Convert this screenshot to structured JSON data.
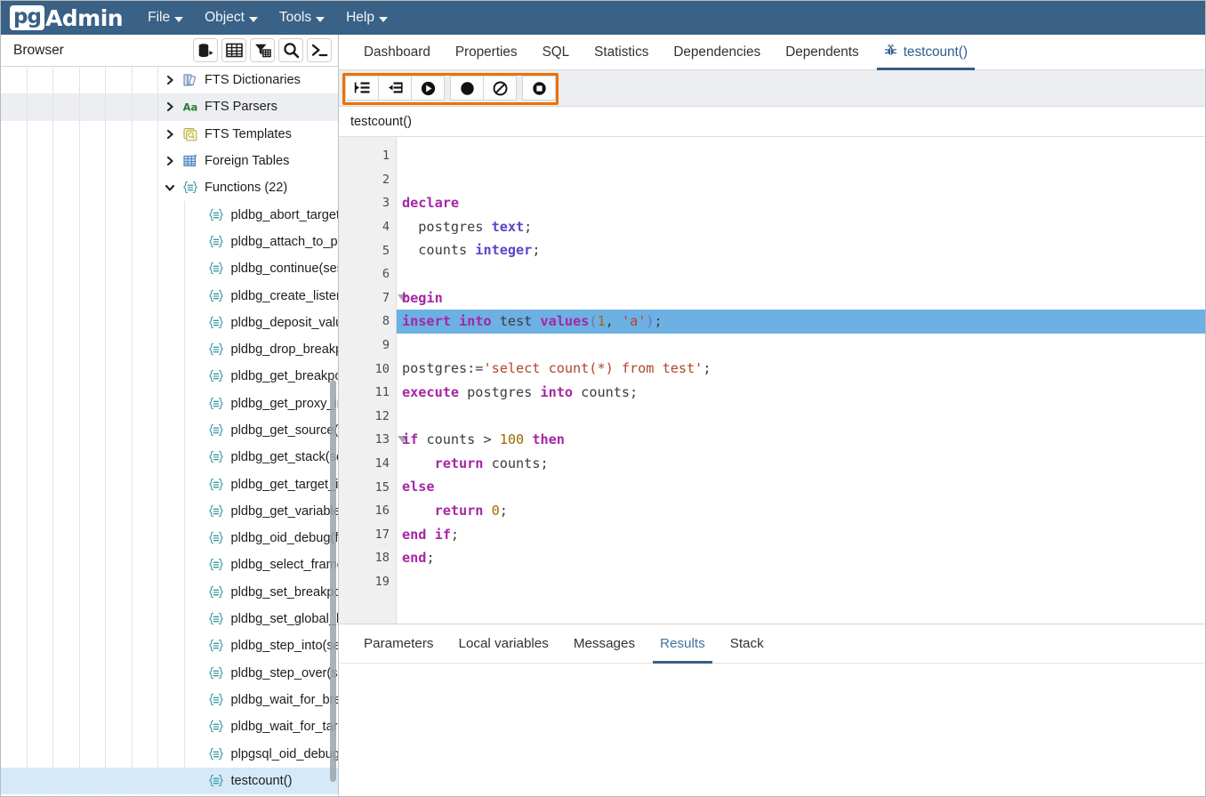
{
  "app": {
    "brand_pg": "pg",
    "brand_admin": "Admin",
    "menu": [
      {
        "label": "File",
        "icon": "chevron-down-icon"
      },
      {
        "label": "Object",
        "icon": "chevron-down-icon"
      },
      {
        "label": "Tools",
        "icon": "chevron-down-icon"
      },
      {
        "label": "Help",
        "icon": "chevron-down-icon"
      }
    ],
    "accent_blue": "#3a6186",
    "highlight_orange": "#f07000",
    "selected_row_blue": "#d6e9f8",
    "exec_line_blue": "#6cb0e4"
  },
  "browser": {
    "title": "Browser",
    "buttons": [
      {
        "name": "add-server-icon",
        "title": "Add New Server"
      },
      {
        "name": "table-grid-icon",
        "title": "View Data"
      },
      {
        "name": "filter-table-icon",
        "title": "Filtered Rows"
      },
      {
        "name": "search-icon",
        "title": "Search Objects"
      },
      {
        "name": "terminal-icon",
        "title": "PSQL Tool"
      }
    ],
    "tree": [
      {
        "label": "FTS Dictionaries",
        "icon": "fts-dictionaries-icon",
        "indent": 7,
        "twisty": "collapsed",
        "state": "normal"
      },
      {
        "label": "FTS Parsers",
        "icon": "fts-parsers-icon",
        "indent": 7,
        "twisty": "collapsed",
        "state": "hovered"
      },
      {
        "label": "FTS Templates",
        "icon": "fts-templates-icon",
        "indent": 7,
        "twisty": "collapsed",
        "state": "normal"
      },
      {
        "label": "Foreign Tables",
        "icon": "foreign-tables-icon",
        "indent": 7,
        "twisty": "collapsed",
        "state": "normal"
      },
      {
        "label": "Functions (22)",
        "icon": "functions-folder-icon",
        "indent": 7,
        "twisty": "expanded",
        "state": "normal"
      },
      {
        "label": "pldbg_abort_target(sess",
        "icon": "function-icon",
        "indent": 8,
        "twisty": "none",
        "state": "normal"
      },
      {
        "label": "pldbg_attach_to_port(po",
        "icon": "function-icon",
        "indent": 8,
        "twisty": "none",
        "state": "normal"
      },
      {
        "label": "pldbg_continue(session",
        "icon": "function-icon",
        "indent": 8,
        "twisty": "none",
        "state": "normal"
      },
      {
        "label": "pldbg_create_listener()",
        "icon": "function-icon",
        "indent": 8,
        "twisty": "none",
        "state": "normal"
      },
      {
        "label": "pldbg_deposit_value(ses",
        "icon": "function-icon",
        "indent": 8,
        "twisty": "none",
        "state": "normal"
      },
      {
        "label": "pldbg_drop_breakpoint(s",
        "icon": "function-icon",
        "indent": 8,
        "twisty": "none",
        "state": "normal"
      },
      {
        "label": "pldbg_get_breakpoints(s",
        "icon": "function-icon",
        "indent": 8,
        "twisty": "none",
        "state": "normal"
      },
      {
        "label": "pldbg_get_proxy_info()",
        "icon": "function-icon",
        "indent": 8,
        "twisty": "none",
        "state": "normal"
      },
      {
        "label": "pldbg_get_source(sessio",
        "icon": "function-icon",
        "indent": 8,
        "twisty": "none",
        "state": "normal"
      },
      {
        "label": "pldbg_get_stack(session",
        "icon": "function-icon",
        "indent": 8,
        "twisty": "none",
        "state": "normal"
      },
      {
        "label": "pldbg_get_target_info(si",
        "icon": "function-icon",
        "indent": 8,
        "twisty": "none",
        "state": "normal"
      },
      {
        "label": "pldbg_get_variables(ses",
        "icon": "function-icon",
        "indent": 8,
        "twisty": "none",
        "state": "normal"
      },
      {
        "label": "pldbg_oid_debug(functio",
        "icon": "function-icon",
        "indent": 8,
        "twisty": "none",
        "state": "normal"
      },
      {
        "label": "pldbg_select_frame(ses",
        "icon": "function-icon",
        "indent": 8,
        "twisty": "none",
        "state": "normal"
      },
      {
        "label": "pldbg_set_breakpoint(se",
        "icon": "function-icon",
        "indent": 8,
        "twisty": "none",
        "state": "normal"
      },
      {
        "label": "pldbg_set_global_breakp",
        "icon": "function-icon",
        "indent": 8,
        "twisty": "none",
        "state": "normal"
      },
      {
        "label": "pldbg_step_into(session",
        "icon": "function-icon",
        "indent": 8,
        "twisty": "none",
        "state": "normal"
      },
      {
        "label": "pldbg_step_over(session",
        "icon": "function-icon",
        "indent": 8,
        "twisty": "none",
        "state": "normal"
      },
      {
        "label": "pldbg_wait_for_breakpo",
        "icon": "function-icon",
        "indent": 8,
        "twisty": "none",
        "state": "normal"
      },
      {
        "label": "pldbg_wait_for_target(se",
        "icon": "function-icon",
        "indent": 8,
        "twisty": "none",
        "state": "normal"
      },
      {
        "label": "plpgsql_oid_debug(func",
        "icon": "function-icon",
        "indent": 8,
        "twisty": "none",
        "state": "normal"
      },
      {
        "label": "testcount()",
        "icon": "function-icon",
        "indent": 8,
        "twisty": "none",
        "state": "selected"
      }
    ]
  },
  "main": {
    "tabs": [
      {
        "label": "Dashboard",
        "active": false,
        "icon": null
      },
      {
        "label": "Properties",
        "active": false,
        "icon": null
      },
      {
        "label": "SQL",
        "active": false,
        "icon": null
      },
      {
        "label": "Statistics",
        "active": false,
        "icon": null
      },
      {
        "label": "Dependencies",
        "active": false,
        "icon": null
      },
      {
        "label": "Dependents",
        "active": false,
        "icon": null
      },
      {
        "label": "testcount()",
        "active": true,
        "icon": "bug-icon"
      }
    ],
    "debugger_toolbar": [
      {
        "name": "step-into-button",
        "icon": "step-into-icon",
        "group": 0
      },
      {
        "name": "step-over-button",
        "icon": "step-over-icon",
        "group": 0
      },
      {
        "name": "continue-button",
        "icon": "play-continue-icon",
        "group": 0
      },
      {
        "name": "toggle-breakpoint-button",
        "icon": "breakpoint-dot-icon",
        "group": 1
      },
      {
        "name": "clear-breakpoints-button",
        "icon": "no-entry-icon",
        "group": 1
      },
      {
        "name": "stop-button",
        "icon": "stop-square-icon",
        "group": 2
      }
    ],
    "function_name": "testcount()",
    "editor": {
      "current_line": 8,
      "fold_lines": [
        7,
        13
      ],
      "lines": [
        {
          "n": 1,
          "tokens": []
        },
        {
          "n": 2,
          "tokens": []
        },
        {
          "n": 3,
          "tokens": [
            {
              "t": "declare",
              "c": "kw"
            }
          ]
        },
        {
          "n": 4,
          "tokens": [
            {
              "t": "  postgres ",
              "c": "pln"
            },
            {
              "t": "text",
              "c": "typ"
            },
            {
              "t": ";",
              "c": "pln"
            }
          ]
        },
        {
          "n": 5,
          "tokens": [
            {
              "t": "  counts ",
              "c": "pln"
            },
            {
              "t": "integer",
              "c": "typ"
            },
            {
              "t": ";",
              "c": "pln"
            }
          ]
        },
        {
          "n": 6,
          "tokens": []
        },
        {
          "n": 7,
          "tokens": [
            {
              "t": "begin",
              "c": "kw"
            }
          ]
        },
        {
          "n": 8,
          "tokens": [
            {
              "t": "insert into",
              "c": "kw"
            },
            {
              "t": " test ",
              "c": "pln"
            },
            {
              "t": "values",
              "c": "kw"
            },
            {
              "t": "(",
              "c": "pun"
            },
            {
              "t": "1",
              "c": "num"
            },
            {
              "t": ", ",
              "c": "pln"
            },
            {
              "t": "'a'",
              "c": "str"
            },
            {
              "t": ")",
              "c": "pun"
            },
            {
              "t": ";",
              "c": "pln"
            }
          ]
        },
        {
          "n": 9,
          "tokens": []
        },
        {
          "n": 10,
          "tokens": [
            {
              "t": "postgres:=",
              "c": "pln"
            },
            {
              "t": "'select count(*) from test'",
              "c": "str"
            },
            {
              "t": ";",
              "c": "pln"
            }
          ]
        },
        {
          "n": 11,
          "tokens": [
            {
              "t": "execute",
              "c": "kw"
            },
            {
              "t": " postgres ",
              "c": "pln"
            },
            {
              "t": "into",
              "c": "kw"
            },
            {
              "t": " counts;",
              "c": "pln"
            }
          ]
        },
        {
          "n": 12,
          "tokens": []
        },
        {
          "n": 13,
          "tokens": [
            {
              "t": "if",
              "c": "kw"
            },
            {
              "t": " counts > ",
              "c": "pln"
            },
            {
              "t": "100",
              "c": "num"
            },
            {
              "t": " ",
              "c": "pln"
            },
            {
              "t": "then",
              "c": "kw"
            }
          ]
        },
        {
          "n": 14,
          "tokens": [
            {
              "t": "    ",
              "c": "pln"
            },
            {
              "t": "return",
              "c": "kw"
            },
            {
              "t": " counts;",
              "c": "pln"
            }
          ]
        },
        {
          "n": 15,
          "tokens": [
            {
              "t": "else",
              "c": "kw"
            }
          ]
        },
        {
          "n": 16,
          "tokens": [
            {
              "t": "    ",
              "c": "pln"
            },
            {
              "t": "return",
              "c": "kw"
            },
            {
              "t": " ",
              "c": "pln"
            },
            {
              "t": "0",
              "c": "num"
            },
            {
              "t": ";",
              "c": "pln"
            }
          ]
        },
        {
          "n": 17,
          "tokens": [
            {
              "t": "end if",
              "c": "kw"
            },
            {
              "t": ";",
              "c": "pln"
            }
          ]
        },
        {
          "n": 18,
          "tokens": [
            {
              "t": "end",
              "c": "kw"
            },
            {
              "t": ";",
              "c": "pln"
            }
          ]
        },
        {
          "n": 19,
          "tokens": []
        }
      ]
    },
    "bottom_tabs": [
      {
        "label": "Parameters",
        "active": false
      },
      {
        "label": "Local variables",
        "active": false
      },
      {
        "label": "Messages",
        "active": false
      },
      {
        "label": "Results",
        "active": true
      },
      {
        "label": "Stack",
        "active": false
      }
    ]
  }
}
